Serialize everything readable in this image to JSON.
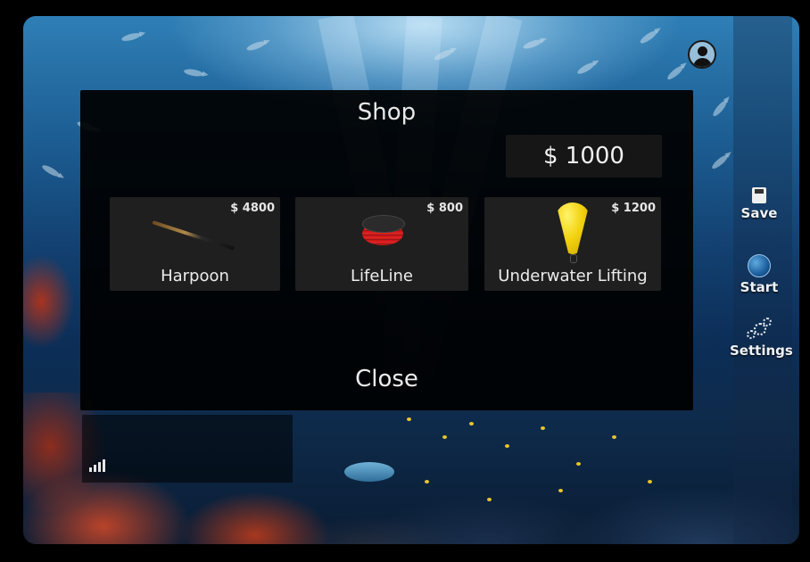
{
  "shop": {
    "title": "Shop",
    "money": "$ 1000",
    "items": [
      {
        "name": "Harpoon",
        "price": "$ 4800"
      },
      {
        "name": "LifeLine",
        "price": "$ 800"
      },
      {
        "name": "Underwater Lifting",
        "price": "$ 1200"
      }
    ],
    "close_label": "Close"
  },
  "side_menu": {
    "save_label": "Save",
    "start_label": "Start",
    "settings_label": "Settings"
  },
  "icons": {
    "profile": "profile-icon",
    "save": "floppy-disk-icon",
    "start": "globe-icon",
    "settings": "gears-icon",
    "signal": "signal-bars-icon"
  },
  "colors": {
    "panel_background": "#000000",
    "item_background": "#1f1f1f",
    "text": "#e8e8e8"
  }
}
